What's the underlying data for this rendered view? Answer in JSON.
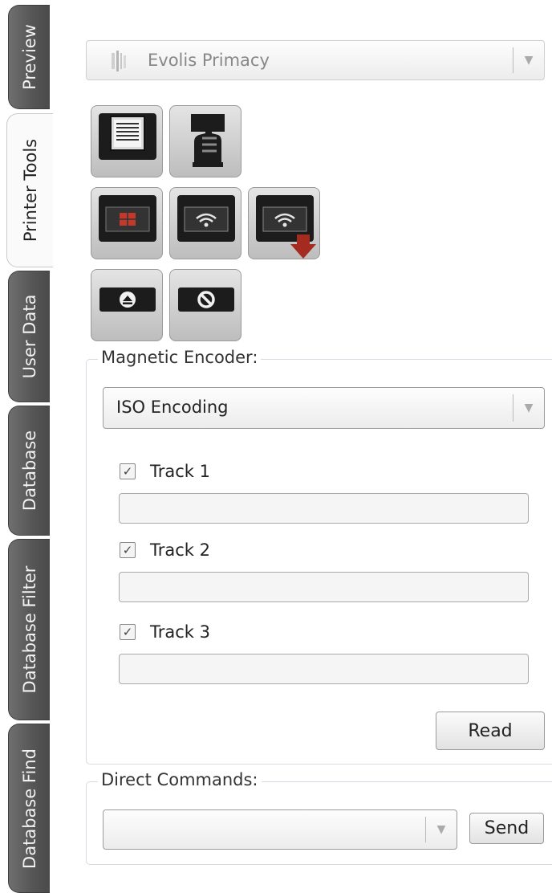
{
  "tabs": [
    {
      "label": "Preview",
      "active": false
    },
    {
      "label": "Printer Tools",
      "active": true
    },
    {
      "label": "User Data",
      "active": false
    },
    {
      "label": "Database",
      "active": false
    },
    {
      "label": "Database Filter",
      "active": false
    },
    {
      "label": "Database Find",
      "active": false
    }
  ],
  "printer": {
    "selected": "Evolis Primacy",
    "icon": "printer-model-icon"
  },
  "tools": [
    {
      "icon": "print-test-card-icon"
    },
    {
      "icon": "manual-feed-hand-icon"
    },
    {
      "icon": "contact-chip-encode-icon"
    },
    {
      "icon": "contactless-encode-icon"
    },
    {
      "icon": "contactless-encode-eject-icon"
    },
    {
      "icon": "eject-card-icon"
    },
    {
      "icon": "cancel-job-icon"
    }
  ],
  "magnetic_encoder": {
    "legend": "Magnetic Encoder:",
    "encoding_selected": "ISO Encoding",
    "tracks": [
      {
        "label": "Track 1",
        "checked": true,
        "value": ""
      },
      {
        "label": "Track 2",
        "checked": true,
        "value": ""
      },
      {
        "label": "Track 3",
        "checked": true,
        "value": ""
      }
    ],
    "read_label": "Read"
  },
  "direct_commands": {
    "legend": "Direct Commands:",
    "command_value": "",
    "send_label": "Send"
  },
  "colors": {
    "accent_red": "#c0392b",
    "tab_dark": "#555555"
  }
}
